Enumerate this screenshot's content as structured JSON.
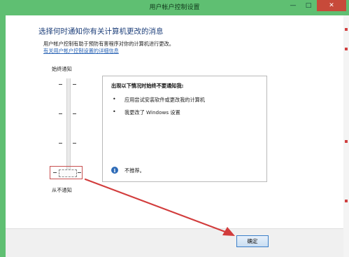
{
  "window": {
    "title": "用户帐户控制设置",
    "minimize_glyph": "—",
    "maximize_glyph": "□",
    "close_glyph": "✕"
  },
  "main": {
    "title": "选择何时通知你有关计算机更改的消息",
    "description": "用户帐户控制有助于预防有害程序对你的计算机进行更改。",
    "details_link": "有关用户帐户控制设置的详细信息"
  },
  "slider": {
    "top_label": "始终通知",
    "bottom_label": "从不通知",
    "level": 0,
    "levels": 4
  },
  "info_panel": {
    "heading": "出现以下情况时始终不要通知我:",
    "bullet_glyph": "•",
    "items": [
      "应用尝试安装软件或更改我的计算机",
      "我更改了 Windows 设置"
    ],
    "info_glyph": "i",
    "note": "不推荐。"
  },
  "footer": {
    "ok_label": "确定"
  },
  "colors": {
    "frame": "#5fbf72",
    "title_text": "#1d3f7a",
    "link": "#2a64b5",
    "annotation_red": "#d23c3c",
    "ok_border": "#3b7fc9"
  }
}
